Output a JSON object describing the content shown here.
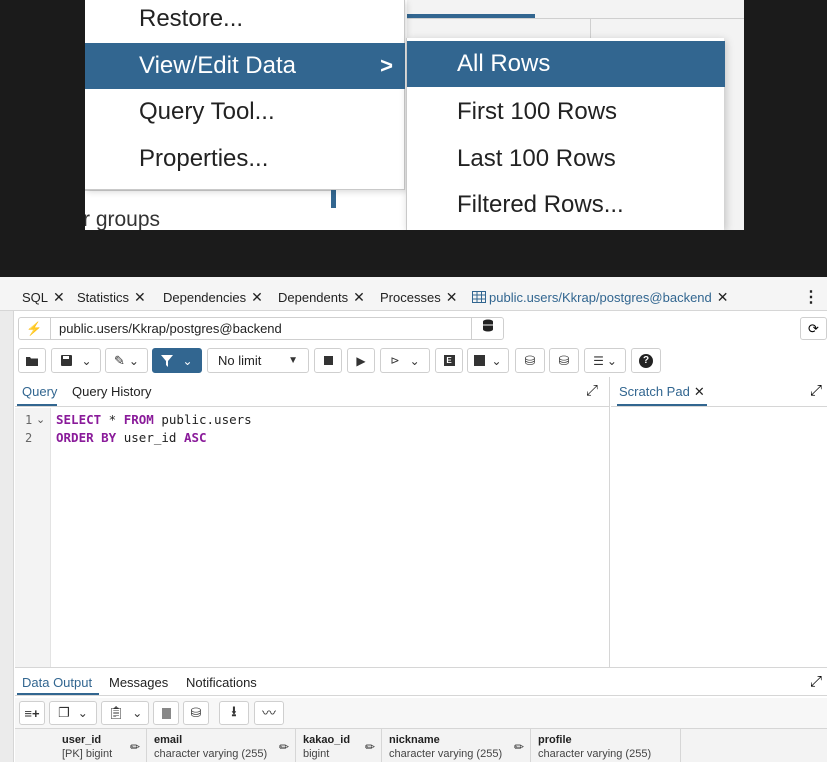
{
  "context_menu": {
    "items": [
      {
        "label": "Restore..."
      },
      {
        "label": "View/Edit Data",
        "arrow": ">"
      },
      {
        "label": "Query Tool..."
      },
      {
        "label": "Properties..."
      }
    ],
    "submenu": [
      {
        "label": "All Rows"
      },
      {
        "label": "First 100 Rows"
      },
      {
        "label": "Last 100 Rows"
      },
      {
        "label": "Filtered Rows..."
      }
    ],
    "background_fragment": "r groups",
    "accent": "#326690"
  },
  "tabs": [
    {
      "label": "SQL"
    },
    {
      "label": "Statistics"
    },
    {
      "label": "Dependencies"
    },
    {
      "label": "Dependents"
    },
    {
      "label": "Processes"
    },
    {
      "label": "public.users/Kkrap/postgres@backend",
      "active": true
    }
  ],
  "connection": {
    "label": "public.users/Kkrap/postgres@backend"
  },
  "toolbar": {
    "limit_label": "No limit"
  },
  "query_tabs": [
    "Query",
    "Query History"
  ],
  "scratch_pad": {
    "label": "Scratch Pad"
  },
  "editor": {
    "lines": [
      {
        "n": "1",
        "kw1": "SELECT",
        "mid1": " * ",
        "kw2": "FROM",
        "rest": " public.users"
      },
      {
        "n": "2",
        "kw1": "ORDER BY",
        "mid1": " user_id ",
        "kw2": "ASC",
        "rest": ""
      }
    ]
  },
  "output_tabs": [
    "Data Output",
    "Messages",
    "Notifications"
  ],
  "columns": [
    {
      "name": "user_id",
      "type": "[PK] bigint"
    },
    {
      "name": "email",
      "type": "character varying (255)"
    },
    {
      "name": "kakao_id",
      "type": "bigint"
    },
    {
      "name": "nickname",
      "type": "character varying (255)"
    },
    {
      "name": "profile",
      "type": "character varying (255)"
    }
  ]
}
